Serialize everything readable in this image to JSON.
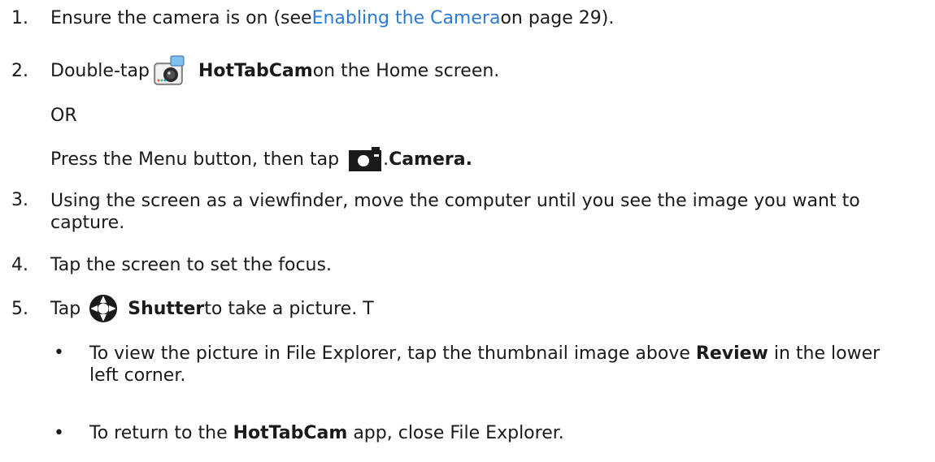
{
  "steps": [
    {
      "num": "1.",
      "pre": "Ensure the camera is on (see ",
      "link": "Enabling the Camera",
      "post": " on page 29)."
    },
    {
      "num": "2.",
      "pre": "Double-tap",
      "icon": "hottabcam-icon",
      "bold": "HotTabCam",
      "post": " on the Home screen."
    },
    {
      "or": "OR"
    },
    {
      "pre": "Press the Menu button, then tap",
      "icon": "camera-icon",
      "dot": ".",
      "bold": "Camera."
    },
    {
      "num": "3.",
      "text": "Using the screen as a viewfinder, move the computer until you see the image you want to capture."
    },
    {
      "num": "4.",
      "text": "Tap the screen to set the focus."
    },
    {
      "num": "5.",
      "pre": "Tap",
      "icon": "shutter-icon",
      "bold": "Shutter",
      "post": " to take a picture. T"
    }
  ],
  "bullets": [
    {
      "marker": "•",
      "pre": "To view the picture in File Explorer, tap the thumbnail image above ",
      "bold": "Review",
      "post": " in the lower left corner."
    },
    {
      "marker": "•",
      "pre": "To return to the ",
      "bold": "HotTabCam",
      "post": " app, close File Explorer."
    }
  ]
}
